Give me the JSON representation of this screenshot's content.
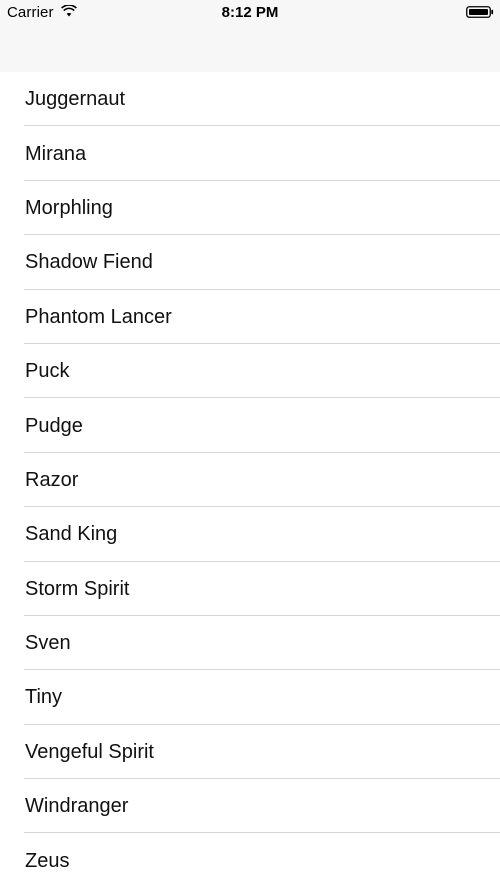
{
  "status_bar": {
    "carrier": "Carrier",
    "time": "8:12 PM",
    "icons": [
      "wifi-icon",
      "battery-icon"
    ]
  },
  "list": {
    "items": [
      {
        "label": "Juggernaut"
      },
      {
        "label": "Mirana"
      },
      {
        "label": "Morphling"
      },
      {
        "label": "Shadow Fiend"
      },
      {
        "label": "Phantom Lancer"
      },
      {
        "label": "Puck"
      },
      {
        "label": "Pudge"
      },
      {
        "label": "Razor"
      },
      {
        "label": "Sand King"
      },
      {
        "label": "Storm Spirit"
      },
      {
        "label": "Sven"
      },
      {
        "label": "Tiny"
      },
      {
        "label": "Vengeful Spirit"
      },
      {
        "label": "Windranger"
      },
      {
        "label": "Zeus"
      }
    ]
  }
}
